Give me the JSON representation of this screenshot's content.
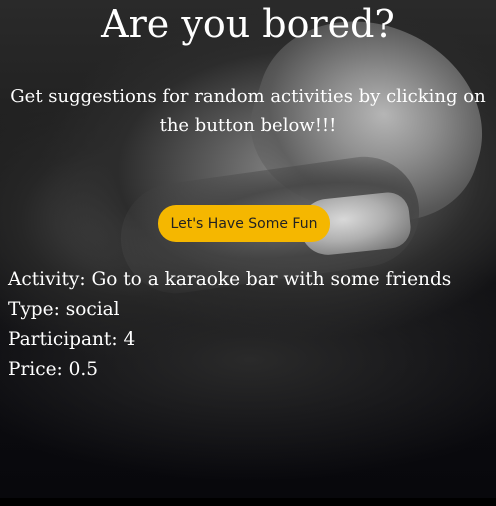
{
  "header": {
    "title": "Are you bored?",
    "subtitle": "Get suggestions for random activities by clicking on the button below!!!"
  },
  "action": {
    "button_label": "Let's Have Some Fun",
    "button_color": "#f5b700"
  },
  "result": {
    "activity_label": "Activity:",
    "activity": "Go to a karaoke bar with some friends",
    "type_label": "Type:",
    "type": "social",
    "participants_label": "Participant:",
    "participants": "4",
    "price_label": "Price:",
    "price": "0.5"
  }
}
